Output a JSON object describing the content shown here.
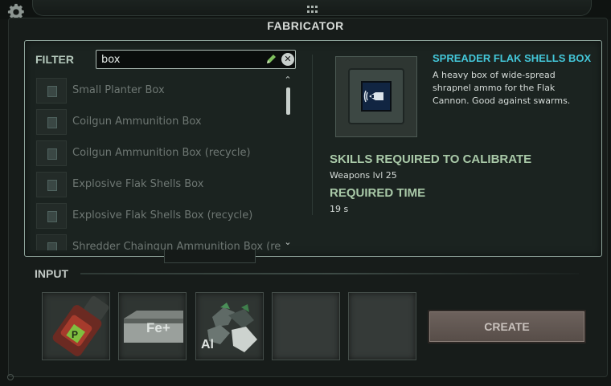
{
  "window": {
    "title": "FABRICATOR"
  },
  "icons": {
    "settings": "gear-icon",
    "drag": "grip-icon",
    "edit": "pencil-icon",
    "clear": "clear-icon"
  },
  "filter": {
    "label": "FILTER",
    "value": "box"
  },
  "recipe_list": [
    {
      "name": "Small Planter Box"
    },
    {
      "name": "Coilgun Ammunition Box"
    },
    {
      "name": "Coilgun Ammunition Box (recycle)"
    },
    {
      "name": "Explosive Flak Shells Box"
    },
    {
      "name": "Explosive Flak Shells Box (recycle)"
    },
    {
      "name": "Shredder Chaingun Ammunition Box (re"
    }
  ],
  "selected_item": {
    "name": "SPREADER FLAK SHELLS BOX",
    "description": "A heavy box of wide-spread shrapnel ammo for the Flak Cannon. Good against swarms.",
    "skills_title": "SKILLS REQUIRED TO CALIBRATE",
    "skills_value": "Weapons lvl 25",
    "time_title": "REQUIRED TIME",
    "time_value": "19 s"
  },
  "input": {
    "label": "INPUT",
    "slots": [
      {
        "icon": "explosive-canister-icon",
        "glyph": "P"
      },
      {
        "icon": "iron-ingot-icon",
        "label": "Fe+"
      },
      {
        "icon": "aluminium-ore-icon",
        "label": "Al"
      },
      {
        "icon": ""
      },
      {
        "icon": ""
      }
    ]
  },
  "create_button": {
    "label": "CREATE"
  },
  "colors": {
    "accent_title": "#43c6d8",
    "section_title": "#a9c9a8",
    "panel_border": "#8fa59c"
  }
}
